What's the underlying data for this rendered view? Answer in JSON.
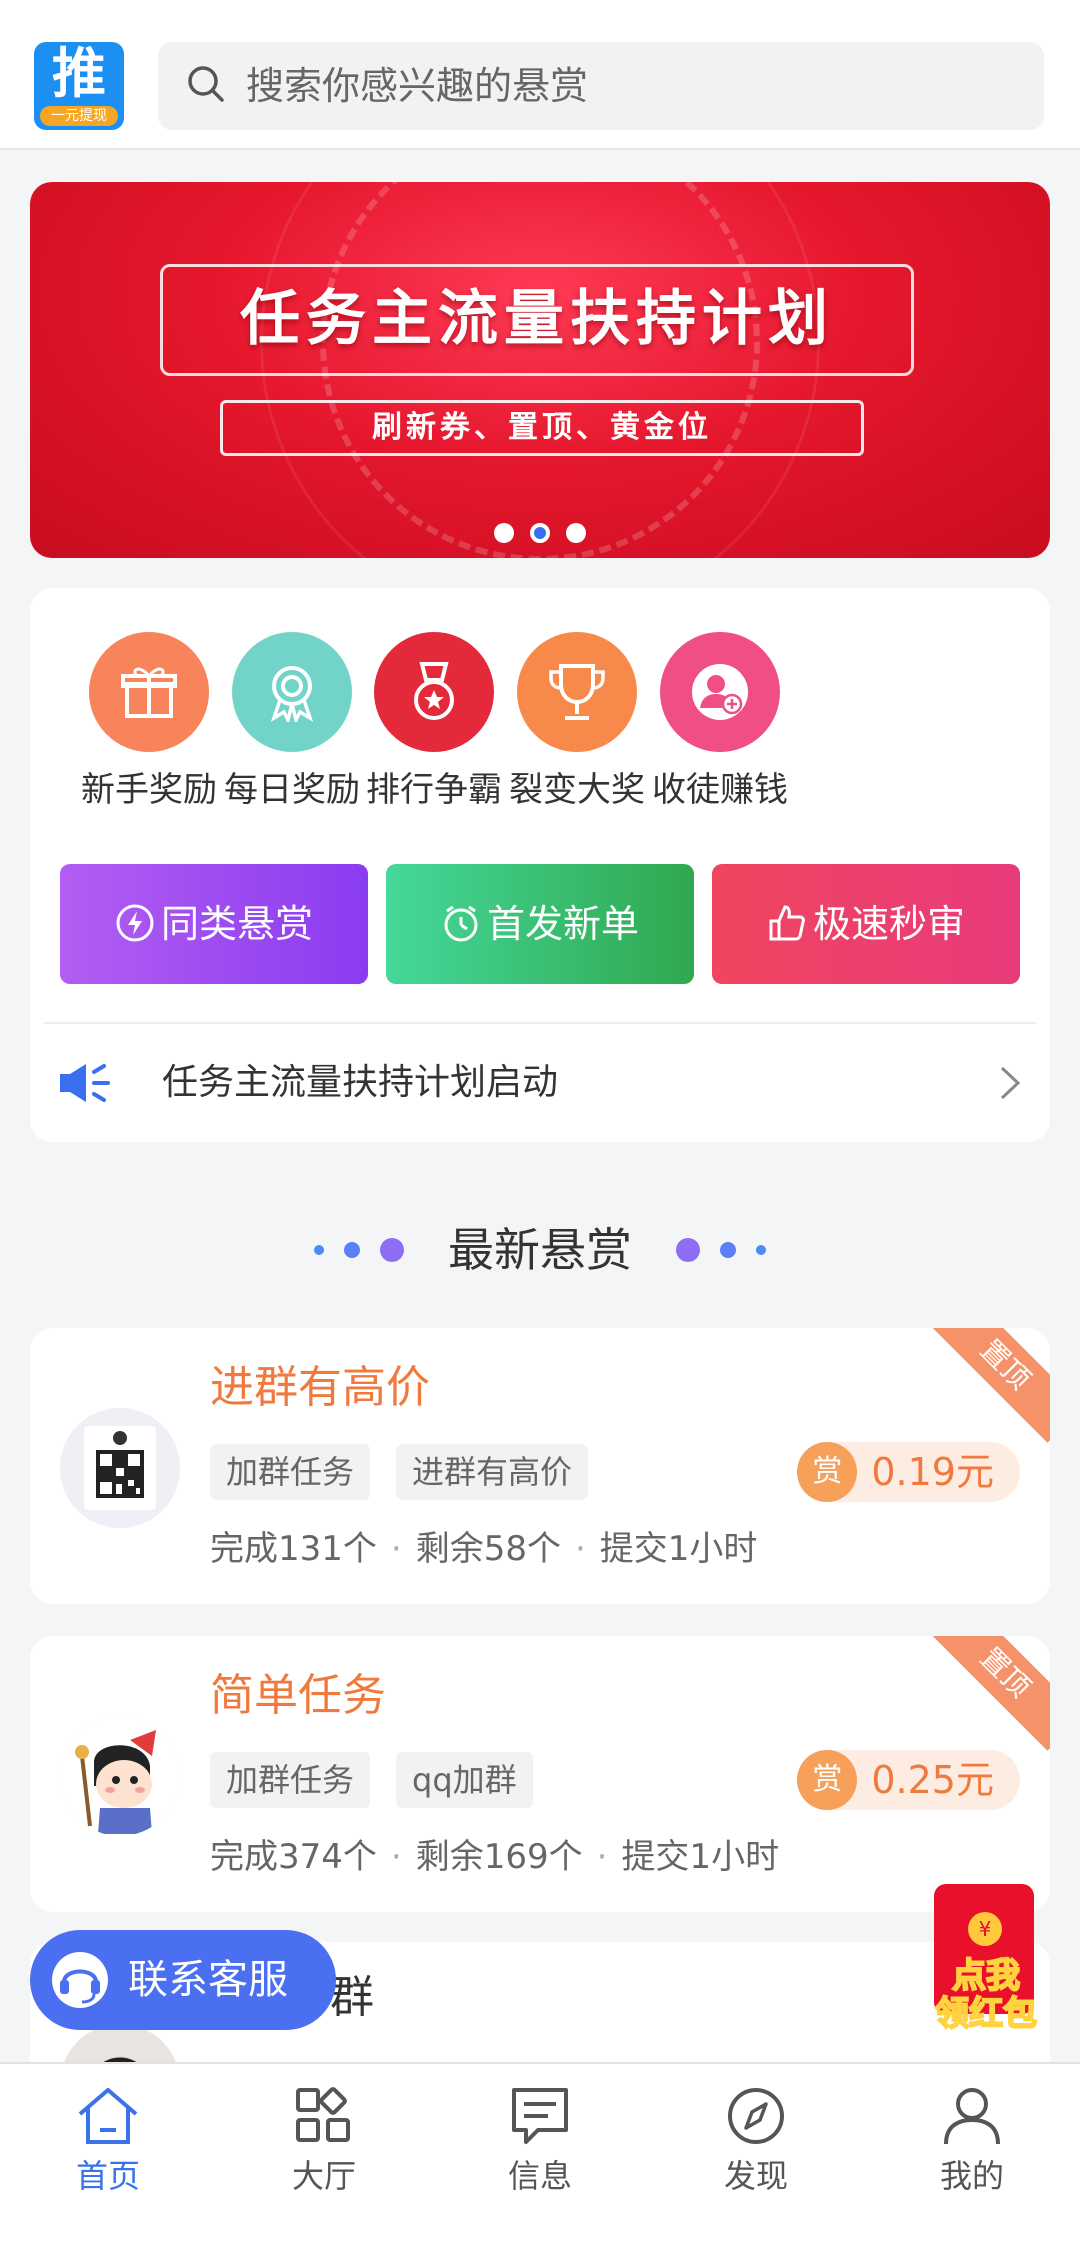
{
  "header": {
    "logo_main": "推",
    "logo_sub": "一元提现",
    "search_placeholder": "搜索你感兴趣的悬赏"
  },
  "banner": {
    "title": "任务主流量扶持计划",
    "subtitle": "刷新券、置顶、黄金位",
    "dots_total": 3,
    "active_dot": 2
  },
  "quick_menu": [
    {
      "label": "新手奖励",
      "icon": "gift-icon",
      "color": "#f7845a"
    },
    {
      "label": "每日奖励",
      "icon": "medal-ribbon-icon",
      "color": "#72d4c8"
    },
    {
      "label": "排行争霸",
      "icon": "star-medal-icon",
      "color": "#e42a3a"
    },
    {
      "label": "裂变大奖",
      "icon": "trophy-icon",
      "color": "#f78a4b"
    },
    {
      "label": "收徒赚钱",
      "icon": "add-user-icon",
      "color": "#f04e86"
    }
  ],
  "promo_buttons": [
    {
      "label": "同类悬赏",
      "icon": "lightning-icon"
    },
    {
      "label": "首发新单",
      "icon": "alarm-clock-icon"
    },
    {
      "label": "极速秒审",
      "icon": "thumbs-up-icon"
    }
  ],
  "notice": {
    "text": "任务主流量扶持计划启动"
  },
  "section": {
    "title": "最新悬赏"
  },
  "tasks": [
    {
      "title": "进群有高价",
      "ribbon": "置顶",
      "tags": [
        "加群任务",
        "进群有高价"
      ],
      "reward_badge": "赏",
      "reward": "0.19元",
      "completed": "完成131个",
      "remaining": "剩余58个",
      "submit": "提交1小时"
    },
    {
      "title": "简单任务",
      "ribbon": "置顶",
      "tags": [
        "加群任务",
        "qq加群"
      ],
      "reward_badge": "赏",
      "reward": "0.25元",
      "completed": "完成374个",
      "remaining": "剩余169个",
      "submit": "提交1小时"
    },
    {
      "title_partial": "群"
    }
  ],
  "floating": {
    "customer_service": "联系客服",
    "redpack_line1": "点我",
    "redpack_line2": "领红包",
    "redpack_coin": "¥"
  },
  "bottom_nav": [
    {
      "label": "首页",
      "icon": "home-icon",
      "active": true
    },
    {
      "label": "大厅",
      "icon": "grid-icon",
      "active": false
    },
    {
      "label": "信息",
      "icon": "message-icon",
      "active": false
    },
    {
      "label": "发现",
      "icon": "compass-icon",
      "active": false
    },
    {
      "label": "我的",
      "icon": "user-icon",
      "active": false
    }
  ],
  "colors": {
    "accent_blue": "#3a73e8",
    "reward_orange": "#f07a3e",
    "banner_red": "#e5172d"
  }
}
